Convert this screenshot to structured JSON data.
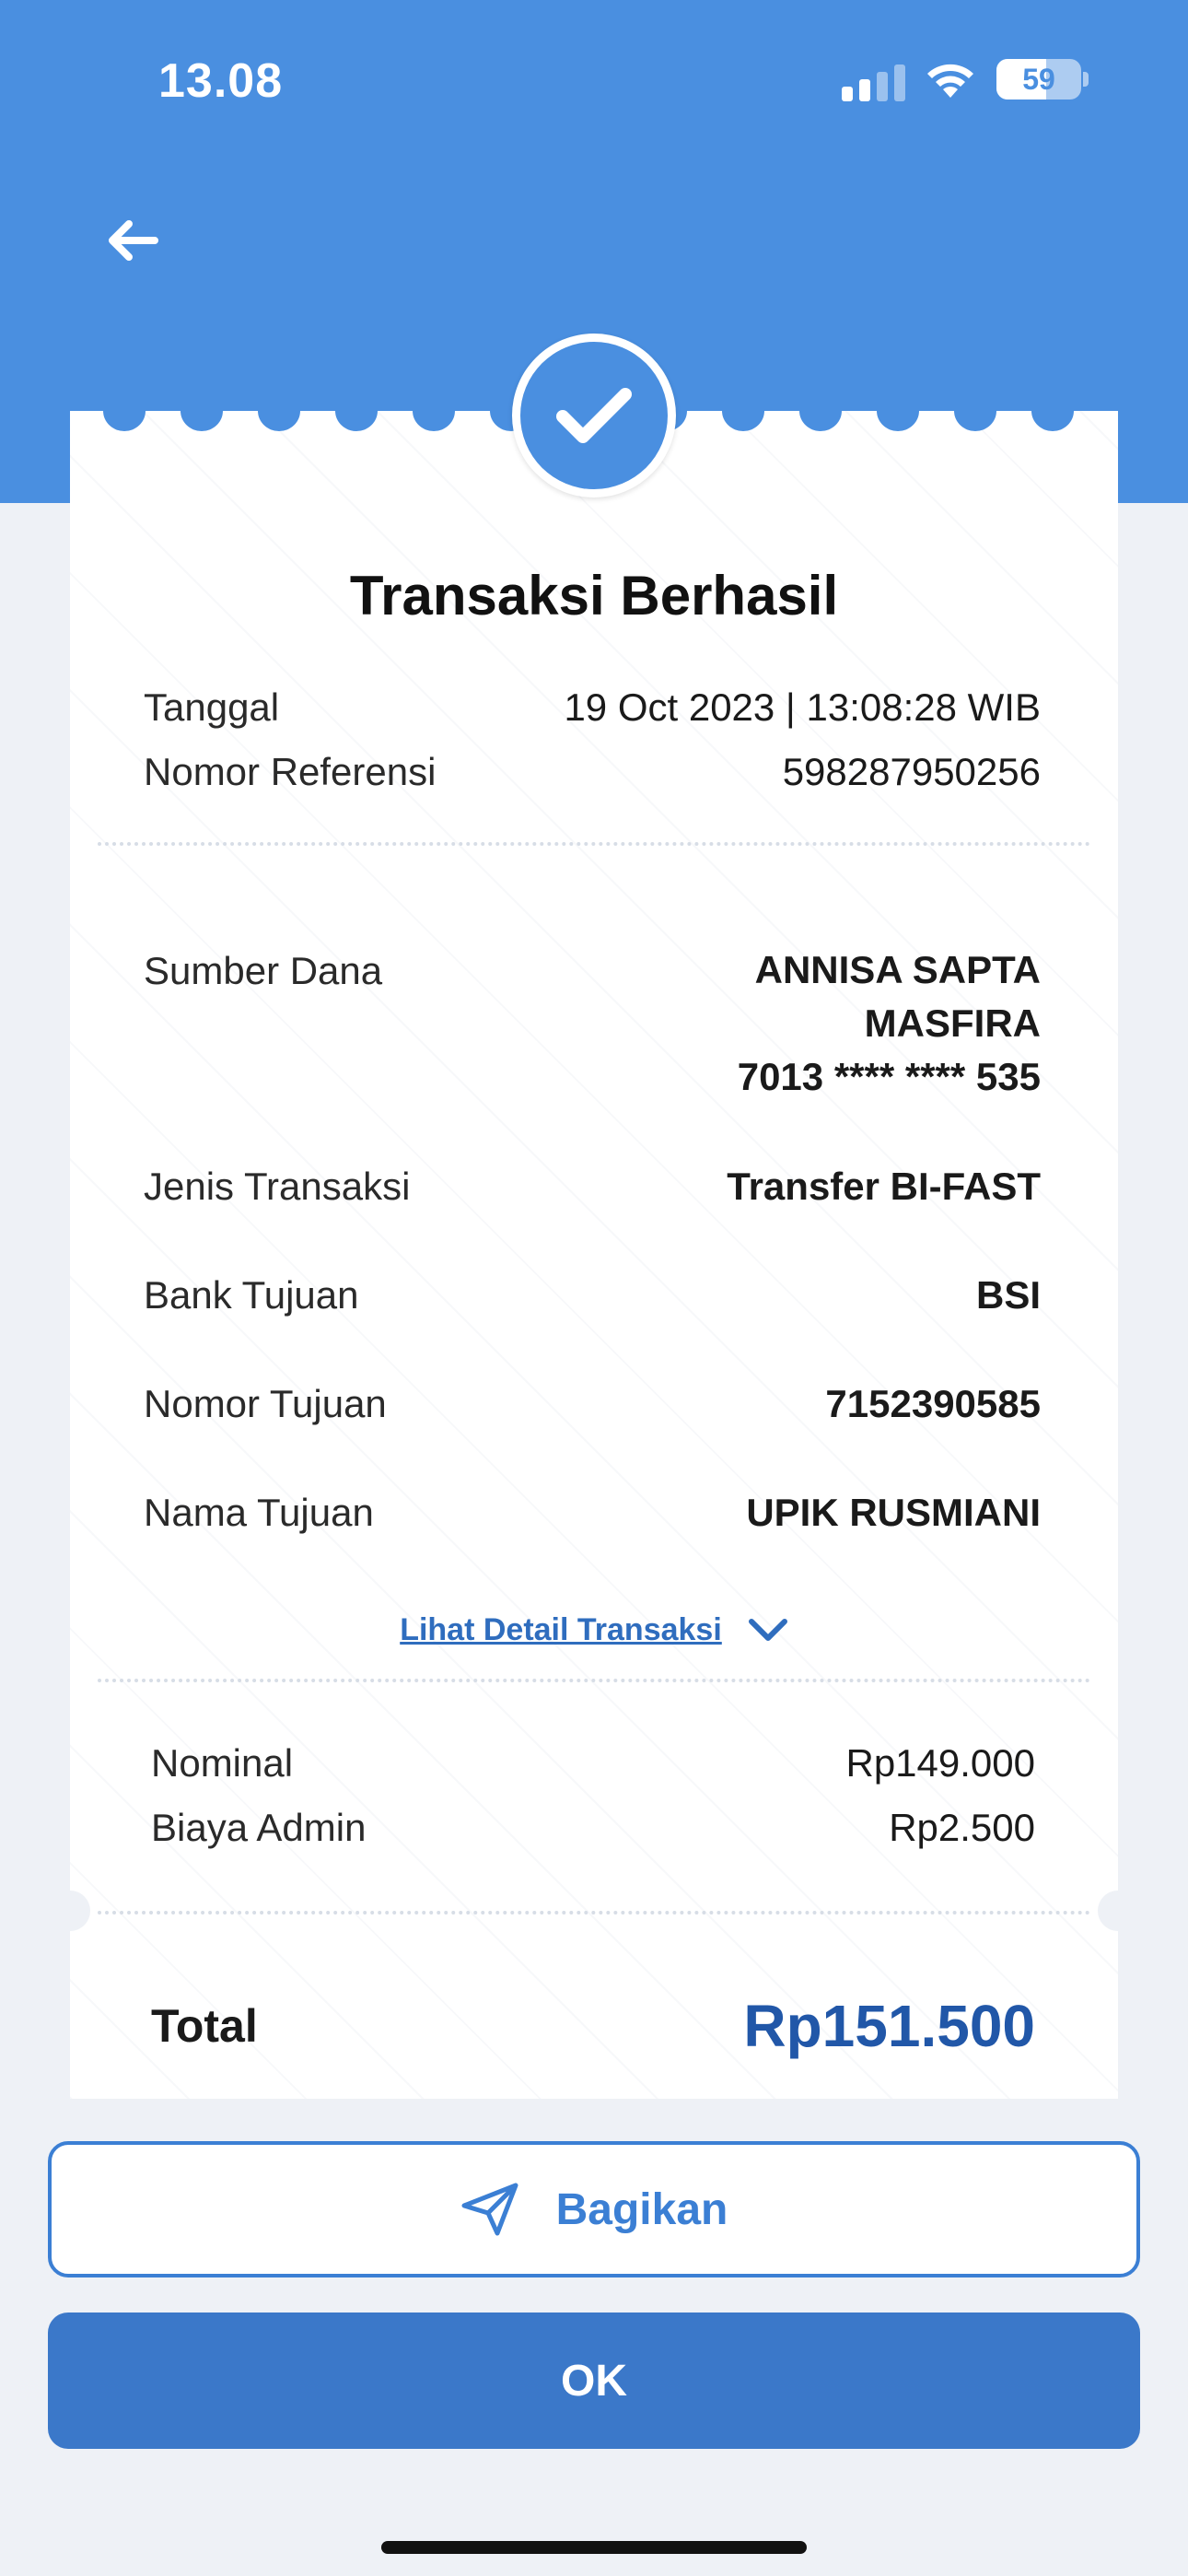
{
  "status_bar": {
    "time": "13.08",
    "battery_level": "59",
    "icons": [
      "cellular-signal-icon",
      "wifi-icon",
      "battery-icon"
    ]
  },
  "header": {
    "back_icon": "arrow-left-icon"
  },
  "receipt": {
    "status_icon": "check-icon",
    "title": "Transaksi Berhasil",
    "meta": [
      {
        "label": "Tanggal",
        "value": "19 Oct 2023 | 13:08:28 WIB"
      },
      {
        "label": "Nomor Referensi",
        "value": "598287950256"
      }
    ],
    "source": {
      "label": "Sumber Dana",
      "name_line1": "ANNISA SAPTA",
      "name_line2": "MASFIRA",
      "account": "7013 **** **** 535"
    },
    "details": [
      {
        "label": "Jenis Transaksi",
        "value": "Transfer BI-FAST"
      },
      {
        "label": "Bank Tujuan",
        "value": "BSI"
      },
      {
        "label": "Nomor Tujuan",
        "value": "7152390585"
      },
      {
        "label": "Nama Tujuan",
        "value": "UPIK RUSMIANI"
      }
    ],
    "detail_link": "Lihat Detail Transaksi",
    "amounts": [
      {
        "label": "Nominal",
        "value": "Rp149.000"
      },
      {
        "label": "Biaya Admin",
        "value": "Rp2.500"
      }
    ],
    "total_label": "Total",
    "total_value": "Rp151.500"
  },
  "actions": {
    "share_label": "Bagikan",
    "share_icon": "send-icon",
    "ok_label": "OK"
  },
  "colors": {
    "header_blue": "#4a8fe0",
    "primary_button": "#3b78c9",
    "total_text": "#2157a8",
    "link": "#2f6dbe"
  }
}
